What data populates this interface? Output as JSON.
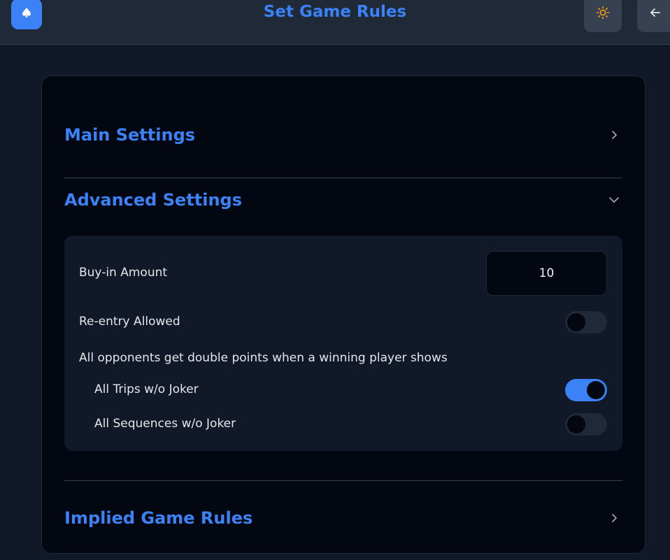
{
  "header": {
    "title": "Set Game Rules",
    "logo_icon": "spade-icon",
    "theme_icon": "sun-icon",
    "back_icon": "arrow-left-icon"
  },
  "sections": {
    "main": {
      "title": "Main Settings",
      "expanded": false
    },
    "advanced": {
      "title": "Advanced Settings",
      "expanded": true
    },
    "implied": {
      "title": "Implied Game Rules",
      "expanded": false
    }
  },
  "advanced": {
    "buy_in": {
      "label": "Buy-in Amount",
      "value": "10"
    },
    "reentry": {
      "label": "Re-entry Allowed",
      "enabled": false
    },
    "double_points_heading": "All opponents get double points when a winning player shows",
    "trips": {
      "label": "All Trips w/o Joker",
      "enabled": true
    },
    "sequences": {
      "label": "All Sequences w/o Joker",
      "enabled": false
    }
  },
  "colors": {
    "accent": "#3b82f6",
    "background": "#111827",
    "card": "#030712",
    "sun": "#f59e0b"
  }
}
